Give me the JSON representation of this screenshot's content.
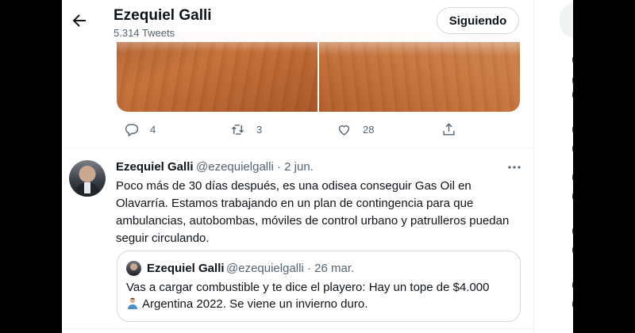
{
  "header": {
    "title": "Ezequiel Galli",
    "tweet_count": "5.314 Tweets",
    "follow_label": "Siguiendo"
  },
  "tweet1": {
    "replies": "4",
    "retweets": "3",
    "likes": "28",
    "icons": [
      "reply-icon",
      "retweet-icon",
      "like-icon",
      "share-icon"
    ]
  },
  "tweet2": {
    "name": "Ezequiel Galli",
    "handle": "@ezequielgalli",
    "date": "2 jun.",
    "text": "Poco más de 30 días después, es una odisea conseguir Gas Oil en Olavarría. Estamos trabajando en un plan de contingencia para que ambulancias, autobombas, móviles de control urbano y patrulleros puedan seguir circulando.",
    "quote": {
      "name": "Ezequiel Galli",
      "handle": "@ezequielgalli",
      "date": "26 mar.",
      "text_line1": "Vas a cargar combustible y te dice el playero: Hay un tope de $4.000",
      "text_line2": "Argentina 2022. Se viene un invierno duro."
    }
  },
  "colors": {
    "text": "#0f1419",
    "secondary": "#536471",
    "border": "#cfd9de"
  }
}
